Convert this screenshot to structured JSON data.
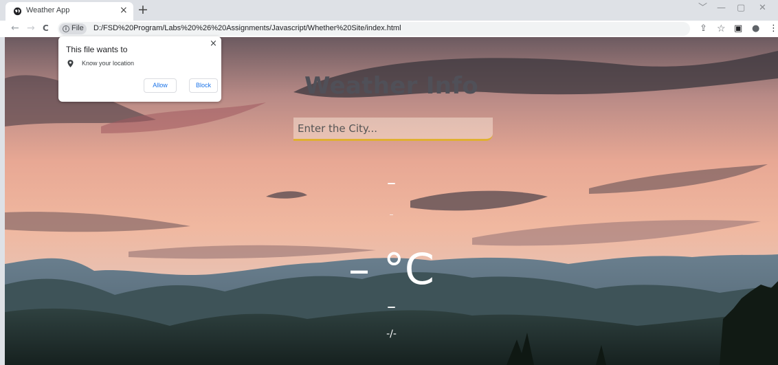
{
  "browser": {
    "tab_title": "Weather App",
    "tab_close": "×",
    "new_tab": "+",
    "chip_label": "File",
    "url": "D:/FSD%20Program/Labs%20%26%20Assignments/Javascript/Whether%20Site/index.html",
    "window_controls": [
      "﹀",
      "—",
      "▢",
      "✕"
    ],
    "nav": {
      "back": "←",
      "forward": "→",
      "reload": "C"
    },
    "toolbar_icons": {
      "share": "⇪",
      "bookmark": "☆",
      "side_panel": "▣",
      "profile": "●",
      "menu": "⋮"
    }
  },
  "permission_popup": {
    "title": "This file wants to",
    "close": "×",
    "item": "Know your location",
    "allow_label": "Allow",
    "block_label": "Block",
    "icons": {
      "pin": "location-pin-icon"
    },
    "accent": "#1a73e8"
  },
  "page": {
    "heading": "Weather Info",
    "search_placeholder": "Enter the City...",
    "city": "–",
    "date": "–",
    "temperature": "– °C",
    "weather": "–",
    "min_max": "-/-",
    "colors": {
      "heading": "#505058",
      "input_underline": "#e0b030",
      "text": "#ffffff"
    }
  }
}
